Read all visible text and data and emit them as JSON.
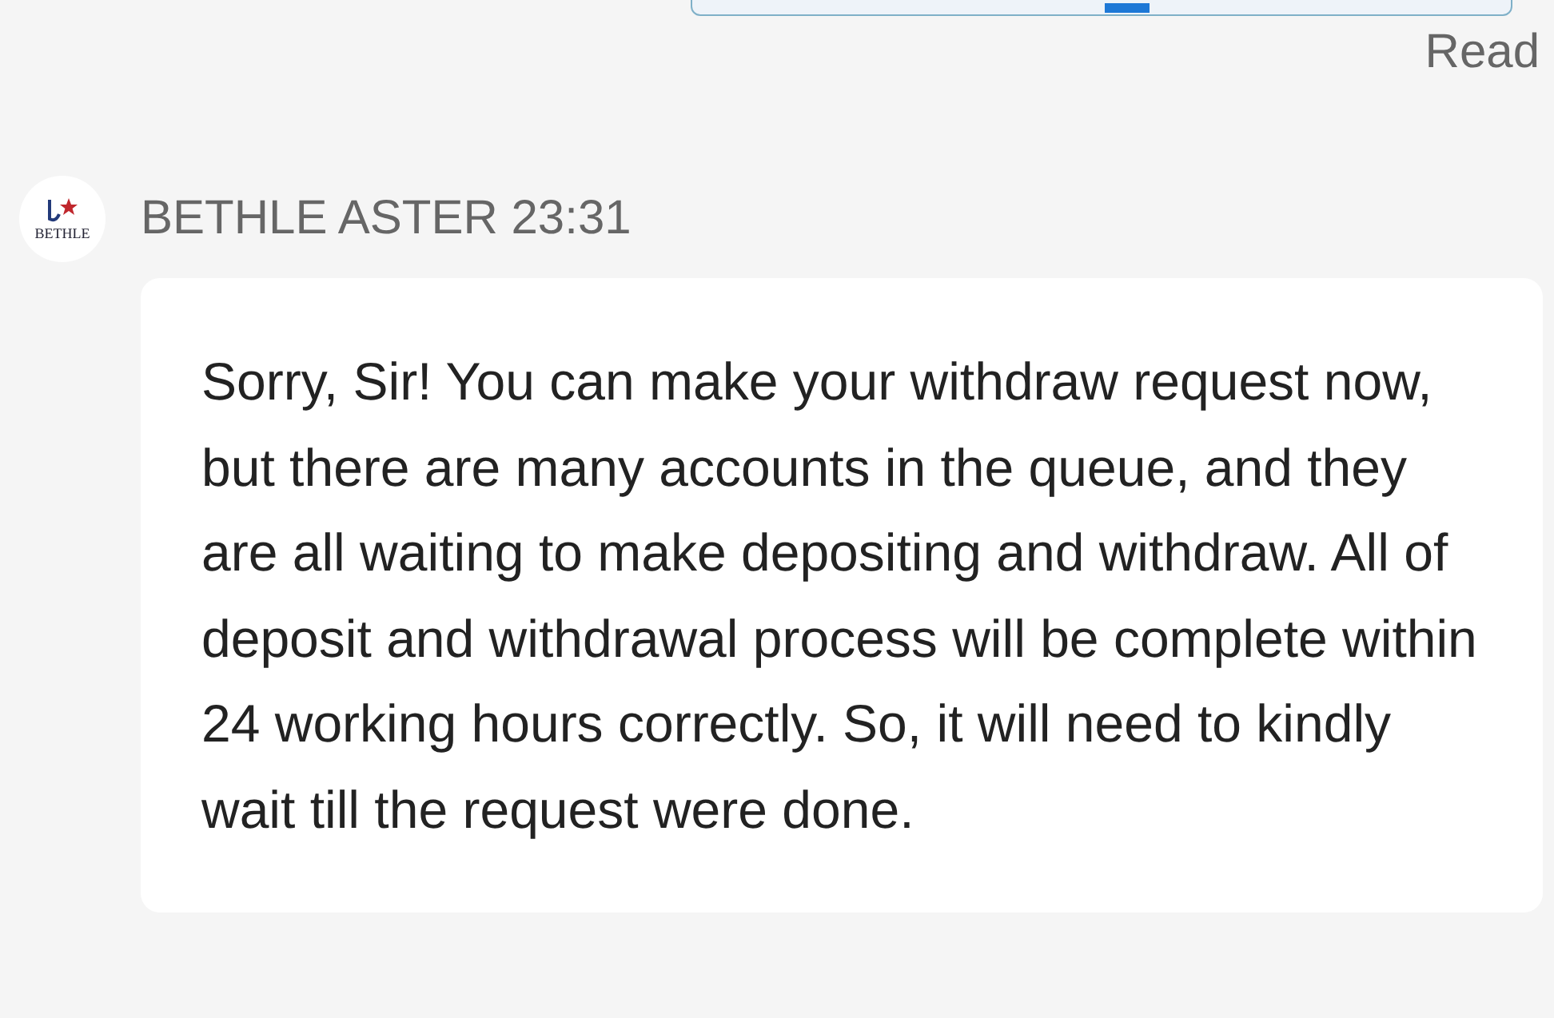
{
  "previous_message": {
    "status": "Read"
  },
  "message": {
    "avatar_logo": "BETHLE",
    "sender": "BETHLE ASTER",
    "time": "23:31",
    "text": "Sorry, Sir! You can make your withdraw request now, but there are many accounts in the queue, and they are all waiting to make depositing and withdraw. All of deposit and withdrawal process will be complete within 24 working hours correctly. So, it will need to kindly wait till the request were done."
  }
}
